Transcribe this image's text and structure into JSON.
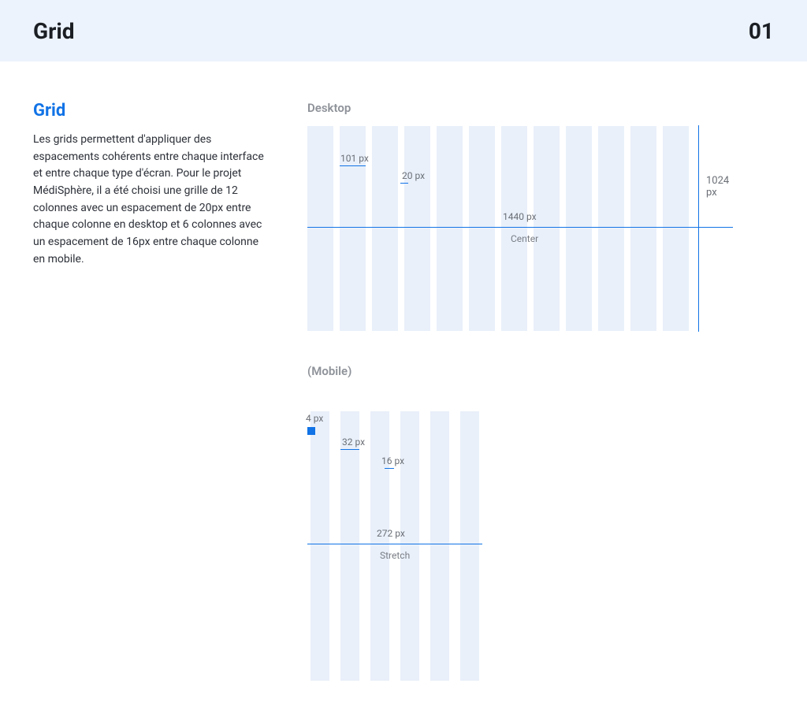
{
  "header": {
    "title": "Grid",
    "page_number": "01"
  },
  "sidebar": {
    "title": "Grid",
    "body": "Les grids permettent d'appliquer des espacements cohérents entre chaque interface et entre chaque type d'écran. Pour le projet MédiSphère, il a été choisi une grille de 12 colonnes avec un espacement de 20px entre chaque colonne en desktop et 6 colonnes avec un espacement de 16px entre chaque colonne en mobile."
  },
  "desktop": {
    "label": "Desktop",
    "column_width": "101 px",
    "gap": "20 px",
    "total_width": "1440 px",
    "align": "Center",
    "height_label": "1024 px",
    "columns": 12
  },
  "mobile": {
    "label": "(Mobile)",
    "margin": "4 px",
    "column_width": "32 px",
    "gap": "16 px",
    "total_width": "272 px",
    "align": "Stretch",
    "columns": 6
  }
}
